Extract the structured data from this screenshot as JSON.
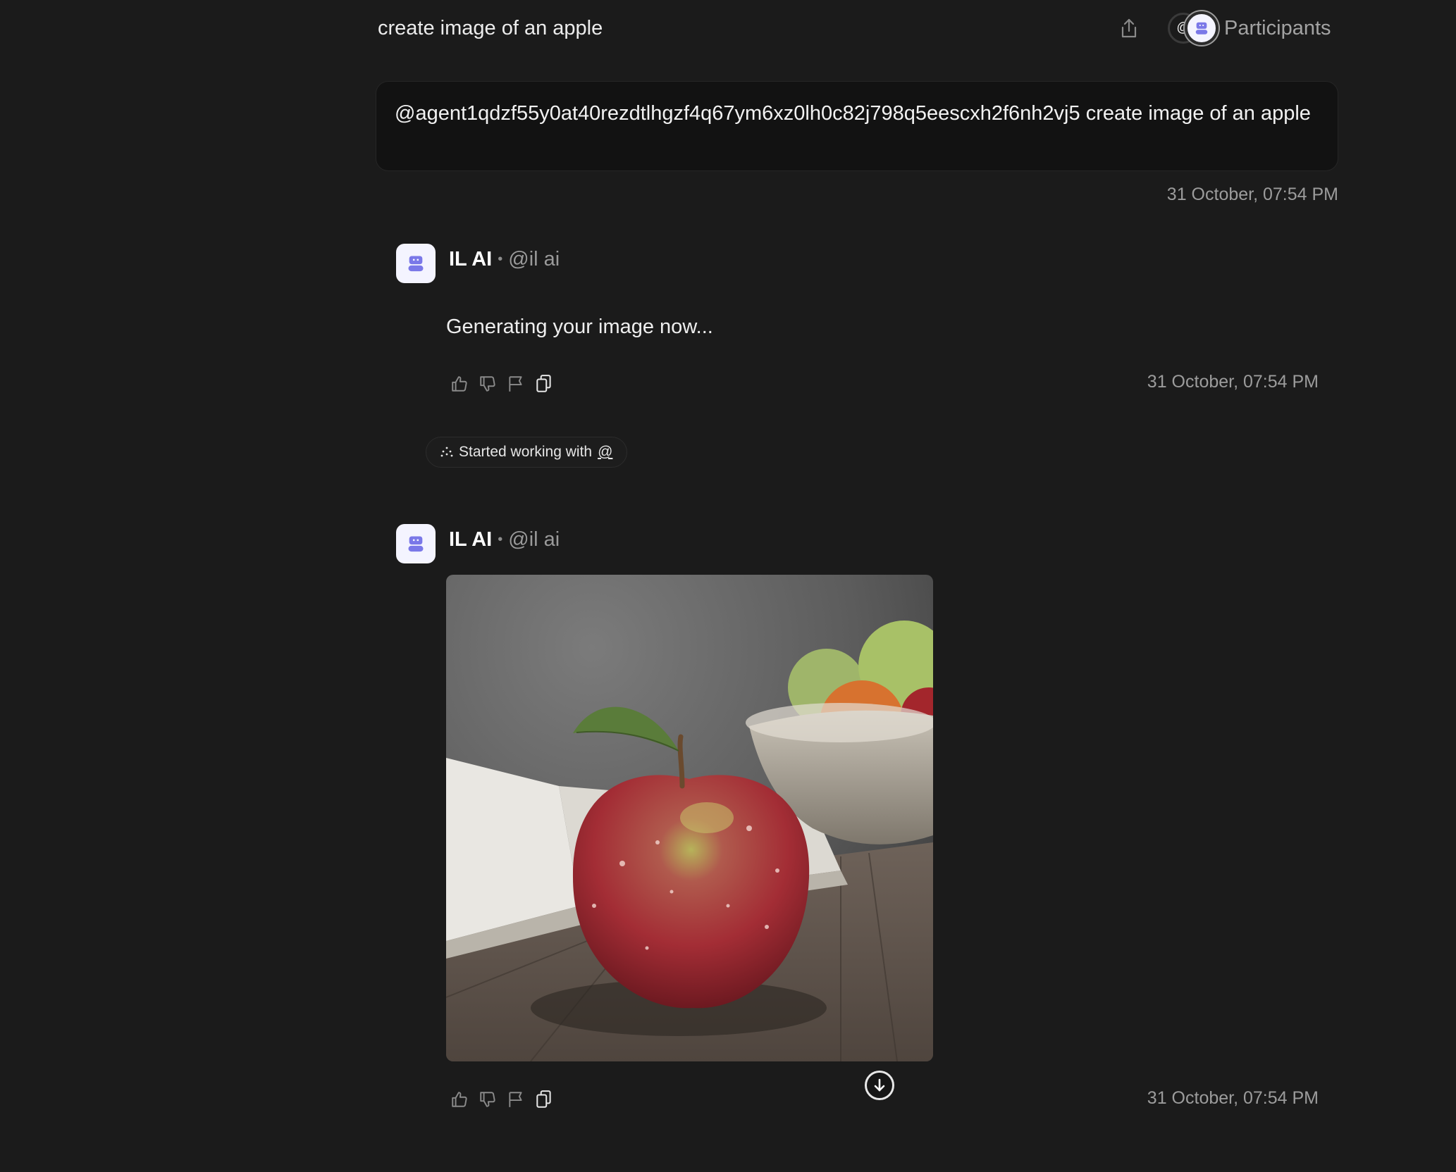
{
  "header": {
    "title": "create image of an apple",
    "participants_label": "Participants",
    "participants_at": "@"
  },
  "user_message": {
    "text": "@agent1qdzf55y0at40rezdtlhgzf4q67ym6xz0lh0c82j798q5eescxh2f6nh2vj5 create image of an apple",
    "timestamp": "31 October, 07:54 PM"
  },
  "messages": [
    {
      "agent_name": "IL AI",
      "separator": "•",
      "handle": "@il ai",
      "text": "Generating your image now...",
      "timestamp": "31 October, 07:54 PM"
    },
    {
      "agent_name": "IL AI",
      "separator": "•",
      "handle": "@il ai",
      "image_alt": "Red apple with green leaf on a wooden table beside an open book and a bowl of fruit",
      "timestamp": "31 October, 07:54 PM"
    }
  ],
  "status_pill": {
    "text": "Started working with",
    "at": "@"
  },
  "colors": {
    "background": "#1b1b1b",
    "accent": "#7a78e8",
    "avatar_bg": "#f4f4ff"
  },
  "icons": [
    "share-icon",
    "bot-icon",
    "thumbs-up-icon",
    "thumbs-down-icon",
    "flag-icon",
    "copy-icon",
    "sparkle-icon",
    "arrow-down-icon"
  ]
}
